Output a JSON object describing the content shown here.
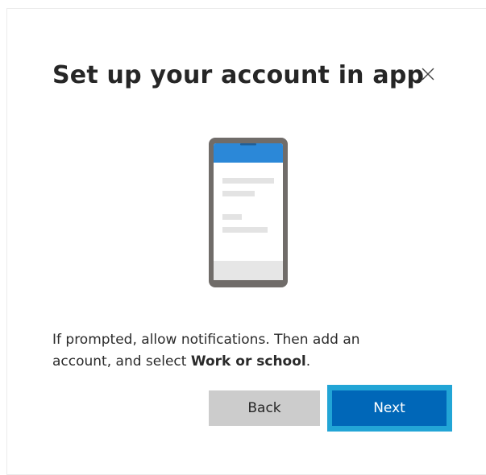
{
  "dialog": {
    "title": "Set up your account in app",
    "close_icon": "close-icon",
    "illustration_icon": "phone-icon",
    "message_part1": "If prompted, allow notifications. Then add an account, and select ",
    "message_bold": "Work or school",
    "message_part2": ".",
    "back_label": "Back",
    "next_label": "Next"
  },
  "colors": {
    "primary": "#0067b8",
    "focus_ring": "#22a5d6",
    "secondary_button": "#cccccc",
    "phone_header": "#2b88d8"
  }
}
